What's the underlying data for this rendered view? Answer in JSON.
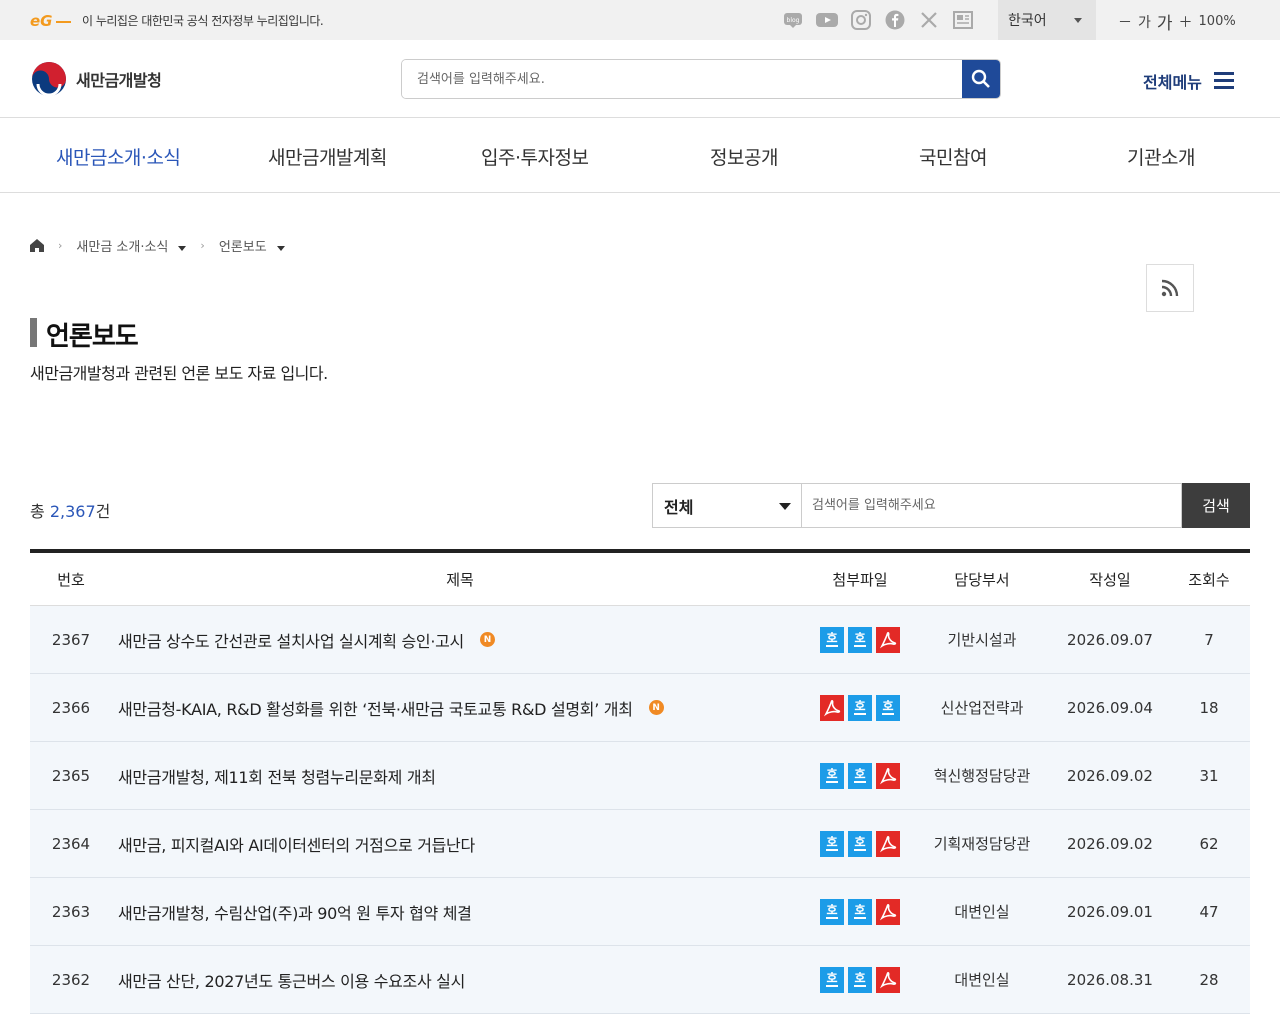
{
  "util": {
    "notice": "이 누리집은 대한민국 공식 전자정부 누리집입니다.",
    "language": "한국어",
    "zoom_small": "가",
    "zoom_large": "가",
    "zoom_level": "100%",
    "sns": [
      "blog-icon",
      "youtube-icon",
      "instagram-icon",
      "facebook-icon",
      "x-icon",
      "news-icon"
    ]
  },
  "header": {
    "logo_text": "새만금개발청",
    "search_placeholder": "검색어를 입력해주세요.",
    "all_menu": "전체메뉴"
  },
  "gnb": [
    "새만금소개·소식",
    "새만금개발계획",
    "입주·투자정보",
    "정보공개",
    "국민참여",
    "기관소개"
  ],
  "breadcrumb": {
    "level1": "새만금 소개·소식",
    "level2": "언론보도"
  },
  "page": {
    "title": "언론보도",
    "description": "새만금개발청과 관련된 언론 보도 자료 입니다."
  },
  "list": {
    "total_prefix": "총 ",
    "total_count": "2,367",
    "total_suffix": "건",
    "filter_selected": "전체",
    "search_placeholder": "검색어를 입력해주세요",
    "search_button": "검색"
  },
  "table": {
    "headers": {
      "no": "번호",
      "title": "제목",
      "attach": "첨부파일",
      "dept": "담당부서",
      "date": "작성일",
      "views": "조회수"
    },
    "rows": [
      {
        "no": "2367",
        "title": "새만금 상수도 간선관로 설치사업 실시계획 승인·고시",
        "new": true,
        "files": [
          "hwp",
          "hwp",
          "pdf"
        ],
        "dept": "기반시설과",
        "date": "2026.09.07",
        "views": "7"
      },
      {
        "no": "2366",
        "title": "새만금청-KAIA, R&D 활성화를 위한 ‘전북·새만금 국토교통 R&D 설명회’ 개최",
        "new": true,
        "files": [
          "pdf",
          "hwp",
          "hwp"
        ],
        "dept": "신산업전략과",
        "date": "2026.09.04",
        "views": "18"
      },
      {
        "no": "2365",
        "title": "새만금개발청, 제11회 전북 청렴누리문화제 개최",
        "new": false,
        "files": [
          "hwp",
          "hwp",
          "pdf"
        ],
        "dept": "혁신행정담당관",
        "date": "2026.09.02",
        "views": "31"
      },
      {
        "no": "2364",
        "title": "새만금, 피지컬AI와 AI데이터센터의 거점으로 거듭난다",
        "new": false,
        "files": [
          "hwp",
          "hwp",
          "pdf"
        ],
        "dept": "기획재정담당관",
        "date": "2026.09.02",
        "views": "62"
      },
      {
        "no": "2363",
        "title": "새만금개발청, 수림산업(주)과 90억 원 투자 협약 체결",
        "new": false,
        "files": [
          "hwp",
          "hwp",
          "pdf"
        ],
        "dept": "대변인실",
        "date": "2026.09.01",
        "views": "47"
      },
      {
        "no": "2362",
        "title": "새만금 산단, 2027년도 통근버스 이용 수요조사 실시",
        "new": false,
        "files": [
          "hwp",
          "hwp",
          "pdf"
        ],
        "dept": "대변인실",
        "date": "2026.08.31",
        "views": "28"
      }
    ]
  },
  "colors": {
    "accent": "#2a56b8",
    "navy": "#1f4a99",
    "new_badge": "#f08a24",
    "hwp": "#1c9ce8",
    "pdf": "#e32a26"
  }
}
